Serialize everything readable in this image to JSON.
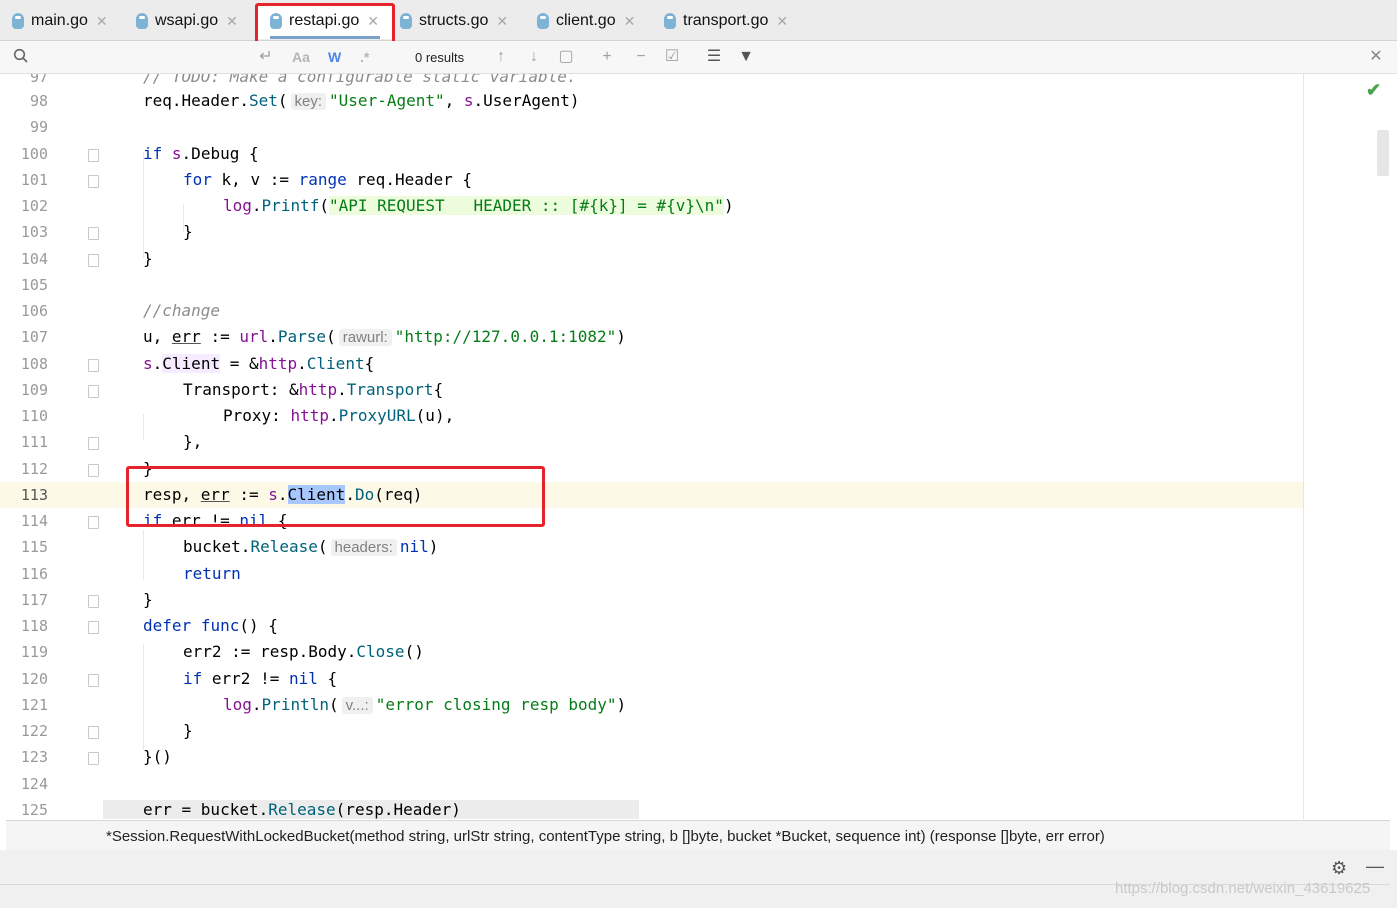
{
  "tabs": [
    {
      "label": "main.go",
      "active": false
    },
    {
      "label": "wsapi.go",
      "active": false
    },
    {
      "label": "restapi.go",
      "active": true
    },
    {
      "label": "structs.go",
      "active": false
    },
    {
      "label": "client.go",
      "active": false
    },
    {
      "label": "transport.go",
      "active": false
    }
  ],
  "search": {
    "results": "0 results",
    "match_case_label": "Aa",
    "words_label": "W",
    "regex_label": ".*"
  },
  "lines": [
    {
      "num": "97"
    },
    {
      "num": "98"
    },
    {
      "num": "99"
    },
    {
      "num": "100"
    },
    {
      "num": "101"
    },
    {
      "num": "102"
    },
    {
      "num": "103"
    },
    {
      "num": "104"
    },
    {
      "num": "105"
    },
    {
      "num": "106"
    },
    {
      "num": "107"
    },
    {
      "num": "108"
    },
    {
      "num": "109"
    },
    {
      "num": "110"
    },
    {
      "num": "111"
    },
    {
      "num": "112"
    },
    {
      "num": "113"
    },
    {
      "num": "114"
    },
    {
      "num": "115"
    },
    {
      "num": "116"
    },
    {
      "num": "117"
    },
    {
      "num": "118"
    },
    {
      "num": "119"
    },
    {
      "num": "120"
    },
    {
      "num": "121"
    },
    {
      "num": "122"
    },
    {
      "num": "123"
    },
    {
      "num": "124"
    },
    {
      "num": "125"
    }
  ],
  "code": {
    "l97": "// TODO: Make a configurable static variable.",
    "l98_a": "req.Header.",
    "l98_fn": "Set",
    "l98_b": "(",
    "l98_hint": "key:",
    "l98_str": "\"User-Agent\"",
    "l98_c": ", ",
    "l98_s": "s",
    "l98_d": ".UserAgent)",
    "l100_kw": "if",
    "l100_s": "s",
    "l100_b": ".Debug {",
    "l101_kw": "for",
    "l101_a": " k, v := ",
    "l101_kw2": "range",
    "l101_b": " req.Header {",
    "l102_pkg": "log",
    "l102_dot": ".",
    "l102_fn": "Printf",
    "l102_open": "(",
    "l102_str": "\"API REQUEST   HEADER :: [#{k}] = #{v}\\n\"",
    "l102_close": ")",
    "l103": "}",
    "l104": "}",
    "l106": "//change",
    "l107_a": "u, ",
    "l107_err": "err",
    "l107_b": " := ",
    "l107_pkg": "url",
    "l107_dot": ".",
    "l107_fn": "Parse",
    "l107_open": "(",
    "l107_hint": "rawurl:",
    "l107_str": "\"http://127.0.0.1:1082\"",
    "l107_close": ")",
    "l108_s": "s",
    "l108_dot": ".",
    "l108_client": "Client",
    "l108_a": " = &",
    "l108_pkg": "http",
    "l108_dot2": ".",
    "l108_type": "Client",
    "l108_b": "{",
    "l109_a": "Transport: &",
    "l109_pkg": "http",
    "l109_dot": ".",
    "l109_type": "Transport",
    "l109_b": "{",
    "l110_a": "Proxy: ",
    "l110_pkg": "http",
    "l110_dot": ".",
    "l110_fn": "ProxyURL",
    "l110_b": "(u),",
    "l111": "},",
    "l112": "}",
    "l113_a": "resp, ",
    "l113_err": "err",
    "l113_b": " := ",
    "l113_s": "s",
    "l113_dot": ".",
    "l113_client": "Client",
    "l113_dot2": ".",
    "l113_fn": "Do",
    "l113_c": "(req)",
    "l114_kw": "if",
    "l114_a": " err != ",
    "l114_kw2": "nil",
    "l114_b": " {",
    "l115_a": "bucket.",
    "l115_fn": "Release",
    "l115_open": "(",
    "l115_hint": "headers:",
    "l115_kw": "nil",
    "l115_close": ")",
    "l116_kw": "return",
    "l117": "}",
    "l118_kw": "defer",
    "l118_kw2": "func",
    "l118_a": "() {",
    "l119_a": "err2 := resp.Body.",
    "l119_fn": "Close",
    "l119_b": "()",
    "l120_kw": "if",
    "l120_a": " err2 != ",
    "l120_kw2": "nil",
    "l120_b": " {",
    "l121_pkg": "log",
    "l121_dot": ".",
    "l121_fn": "Println",
    "l121_open": "(",
    "l121_hint": "v...:",
    "l121_str": "\"error closing resp body\"",
    "l121_close": ")",
    "l122": "}",
    "l123": "}()",
    "l125_a": "err = bucket.",
    "l125_fn": "Release",
    "l125_b": "(resp.Header)"
  },
  "signature": "*Session.RequestWithLockedBucket(method string, urlStr string, contentType string, b []byte, bucket *Bucket, sequence int) (response []byte, err error)",
  "watermark": "https://blog.csdn.net/weixin_43619625",
  "colors": {
    "highlight_box": "#e8222b",
    "keyword": "#0033b3",
    "string": "#067d17",
    "function": "#00627a",
    "package": "#871094"
  }
}
